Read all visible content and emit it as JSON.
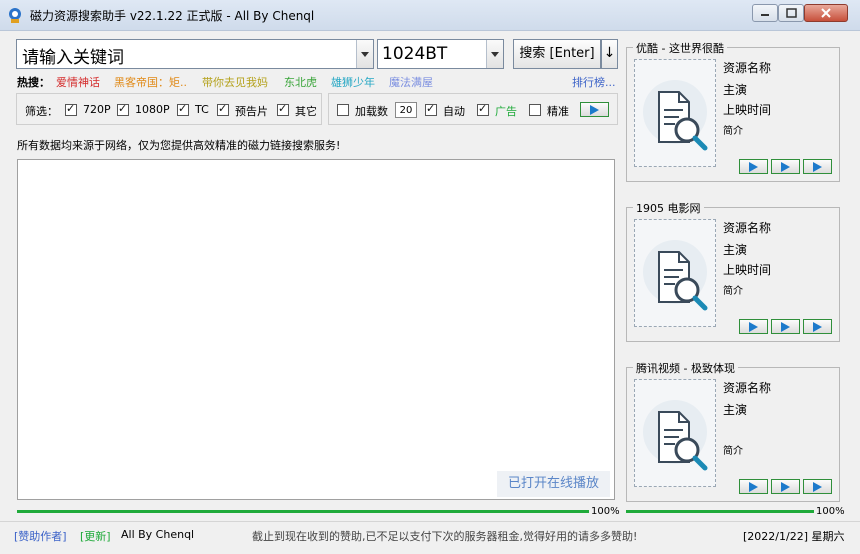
{
  "window": {
    "title": "磁力资源搜索助手 v22.1.22 正式版 - All By Chenql"
  },
  "search": {
    "keyword_value": "请输入关键词",
    "source_value": "1024BT",
    "search_label": "搜索 [Enter]",
    "sort_label": "↓"
  },
  "hot": {
    "label": "热搜：",
    "items": [
      {
        "text": "爱情神话",
        "color": "#d42b2b"
      },
      {
        "text": "黑客帝国：矩..",
        "color": "#e08a18"
      },
      {
        "text": "带你去见我妈",
        "color": "#b5a21c"
      },
      {
        "text": "东北虎",
        "color": "#3aa53a"
      },
      {
        "text": "雄狮少年",
        "color": "#25a7c4"
      },
      {
        "text": "魔法满屋",
        "color": "#7c8fe0"
      }
    ],
    "rank_label": "排行榜..."
  },
  "filter": {
    "label": "筛选：",
    "items": [
      "720P",
      "1080P",
      "TC",
      "预告片",
      "其它"
    ]
  },
  "options": {
    "load_label": "加载数",
    "load_count": "20",
    "auto_label": "自动",
    "ad_label": "广告",
    "exact_label": "精准"
  },
  "info_text": "所有数据均来源于网络，仅为您提供高效精准的磁力链接搜索服务!",
  "online_play_label": "已打开在线播放",
  "progress": {
    "main": 1.0,
    "main_text": "100%",
    "side": 1.0,
    "side_text": "100%"
  },
  "panels": [
    {
      "title": "优酷 - 这世界很酷",
      "name": "资源名称",
      "actor": "主演",
      "date": "上映时间",
      "intro": "简介"
    },
    {
      "title": "1905 电影网",
      "name": "资源名称",
      "actor": "主演",
      "date": "上映时间",
      "intro": "简介"
    },
    {
      "title": "腾讯视频 - 极致体现",
      "name": "资源名称",
      "actor": "主演",
      "date": "",
      "intro": "简介"
    }
  ],
  "status": {
    "sponsor": "[赞助作者]",
    "update": "[更新]",
    "author": "All By Chenql",
    "message": "截止到现在收到的赞助,已不足以支付下次的服务器租金,觉得好用的请多多赞助!",
    "date": "[2022/1/22] 星期六"
  },
  "icons": [
    "app-magnet-icon",
    "minimize-icon",
    "maximize-icon",
    "close-icon",
    "document-search-icon",
    "play-icon"
  ],
  "colors": {
    "accent": "#1faa3a",
    "link": "#3b62c8"
  }
}
